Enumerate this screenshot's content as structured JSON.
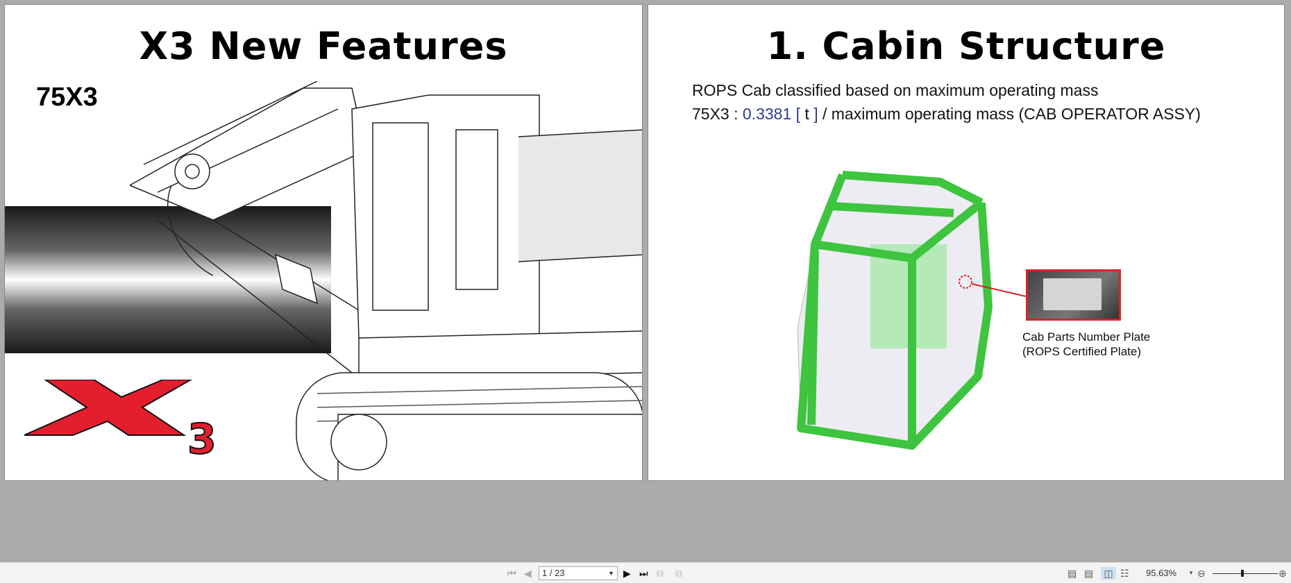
{
  "page1": {
    "title": "X3 New Features",
    "model": "75X3",
    "logo_text": "X3"
  },
  "page2": {
    "title": "1. Cabin Structure",
    "line1": "ROPS Cab classified based on maximum operating mass",
    "line2_prefix": "75X3 : ",
    "line2_value": "0.3381",
    "line2_bracket_open": " [ ",
    "line2_unit": "t",
    "line2_bracket_close": " ]",
    "line2_suffix": " / maximum operating mass (CAB OPERATOR ASSY)",
    "caption1": "Cab Parts Number Plate",
    "caption2": "(ROPS Certified Plate)"
  },
  "toolbar": {
    "page_indicator": "1 / 23",
    "zoom_level": "95.63%"
  },
  "colors": {
    "accent_red": "#d8242a",
    "cab_green": "#3ec43e",
    "value_blue": "#2e3a8c"
  }
}
